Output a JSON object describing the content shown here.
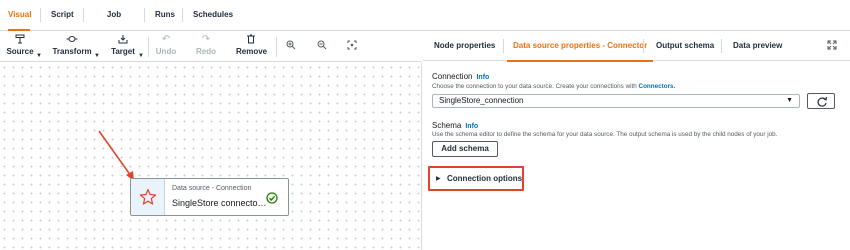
{
  "top_tabs": [
    {
      "label": "Visual",
      "active": true
    },
    {
      "label": "Script",
      "active": false
    },
    {
      "label": "Job details",
      "active": false
    },
    {
      "label": "Runs",
      "active": false
    },
    {
      "label": "Schedules",
      "active": false
    }
  ],
  "toolbar": {
    "source": "Source",
    "transform": "Transform",
    "target": "Target",
    "undo": "Undo",
    "redo": "Redo",
    "remove": "Remove",
    "icons": [
      "source-icon",
      "transform-icon",
      "target-icon",
      "undo-icon",
      "redo-icon",
      "trash-icon",
      "zoom-in-icon",
      "zoom-out-icon",
      "fit-view-icon"
    ]
  },
  "node": {
    "type_label": "Data source - Connection",
    "name": "SingleStore connecto…",
    "status": "valid"
  },
  "panel": {
    "tabs": [
      {
        "label": "Node properties",
        "active": false
      },
      {
        "label": "Data source properties - Connector",
        "active": true
      },
      {
        "label": "Output schema",
        "active": false
      },
      {
        "label": "Data preview",
        "active": false
      }
    ],
    "connection": {
      "label": "Connection",
      "info": "Info",
      "desc": "Choose the connection to your data source. Create your connections with ",
      "desc_link": "Connectors.",
      "value": "SingleStore_connection"
    },
    "schema": {
      "label": "Schema",
      "info": "Info",
      "desc": "Use the schema editor to define the schema for your data source. The output schema is used by the child nodes of your job.",
      "button": "Add schema"
    },
    "connection_options": "Connection options"
  },
  "colors": {
    "accent": "#ec7211",
    "link": "#0073bb",
    "annotation": "#e0452b",
    "success": "#1d8102"
  }
}
